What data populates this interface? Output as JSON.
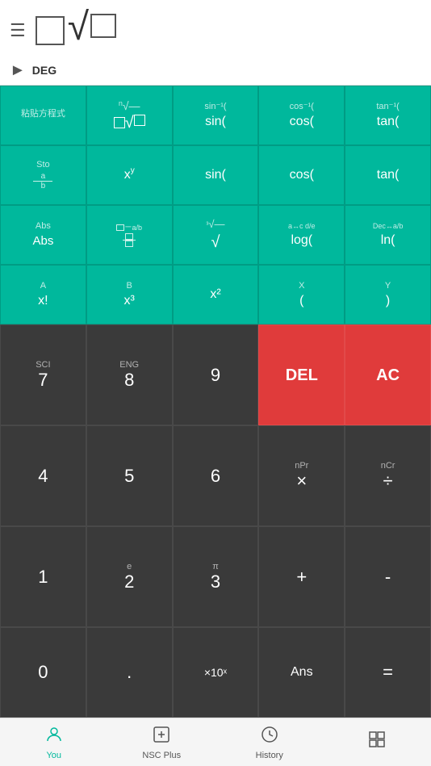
{
  "header": {
    "deg_label": "DEG"
  },
  "sci_rows": [
    [
      {
        "top": "粘贴方程式",
        "main": ""
      },
      {
        "top": "ⁿ√—",
        "main": ""
      },
      {
        "top": "sin⁻¹(",
        "main": "sin("
      },
      {
        "top": "cos⁻¹(",
        "main": "cos("
      },
      {
        "top": "tan⁻¹(",
        "main": "tan("
      }
    ],
    [
      {
        "top": "Sto",
        "main": ""
      },
      {
        "top": "xʸ",
        "main": ""
      },
      {
        "top": "",
        "main": "sin("
      },
      {
        "top": "",
        "main": "cos("
      },
      {
        "top": "",
        "main": "tan("
      }
    ],
    [
      {
        "top": "Abs",
        "main": ""
      },
      {
        "top": "",
        "main": ""
      },
      {
        "top": "³√—",
        "main": "√"
      },
      {
        "top": "a↔c d/e",
        "main": "log("
      },
      {
        "top": "Dec↔a/b",
        "main": "ln("
      }
    ],
    [
      {
        "top": "A",
        "main": "x!"
      },
      {
        "top": "B",
        "main": "x³"
      },
      {
        "top": "",
        "main": "x²"
      },
      {
        "top": "X",
        "main": "("
      },
      {
        "top": "Y",
        "main": ")"
      }
    ]
  ],
  "num_rows": [
    [
      {
        "top": "SCI",
        "main": "7",
        "style": "normal"
      },
      {
        "top": "ENG",
        "main": "8",
        "style": "normal"
      },
      {
        "top": "",
        "main": "9",
        "style": "normal"
      },
      {
        "top": "",
        "main": "DEL",
        "style": "del"
      },
      {
        "top": "",
        "main": "AC",
        "style": "ac"
      }
    ],
    [
      {
        "top": "",
        "main": "4",
        "style": "normal"
      },
      {
        "top": "",
        "main": "5",
        "style": "normal"
      },
      {
        "top": "",
        "main": "6",
        "style": "normal"
      },
      {
        "top": "nPr",
        "main": "×",
        "style": "normal"
      },
      {
        "top": "nCr",
        "main": "÷",
        "style": "normal"
      }
    ],
    [
      {
        "top": "",
        "main": "1",
        "style": "normal"
      },
      {
        "top": "e",
        "main": "2",
        "style": "normal"
      },
      {
        "top": "π",
        "main": "3",
        "style": "normal"
      },
      {
        "top": "",
        "main": "+",
        "style": "normal"
      },
      {
        "top": "",
        "main": "-",
        "style": "normal"
      }
    ],
    [
      {
        "top": "",
        "main": "0",
        "style": "normal"
      },
      {
        "top": "",
        "main": ".",
        "style": "normal"
      },
      {
        "top": "",
        "main": "×10ˣ",
        "style": "normal"
      },
      {
        "top": "",
        "main": "Ans",
        "style": "normal"
      },
      {
        "top": "",
        "main": "=",
        "style": "normal"
      }
    ]
  ],
  "nav": {
    "items": [
      {
        "icon": "person",
        "label": "You",
        "active": true
      },
      {
        "icon": "plus-square",
        "label": "NSC Plus",
        "active": false
      },
      {
        "icon": "clock",
        "label": "History",
        "active": false
      },
      {
        "icon": "grid",
        "label": "",
        "active": false
      }
    ]
  }
}
